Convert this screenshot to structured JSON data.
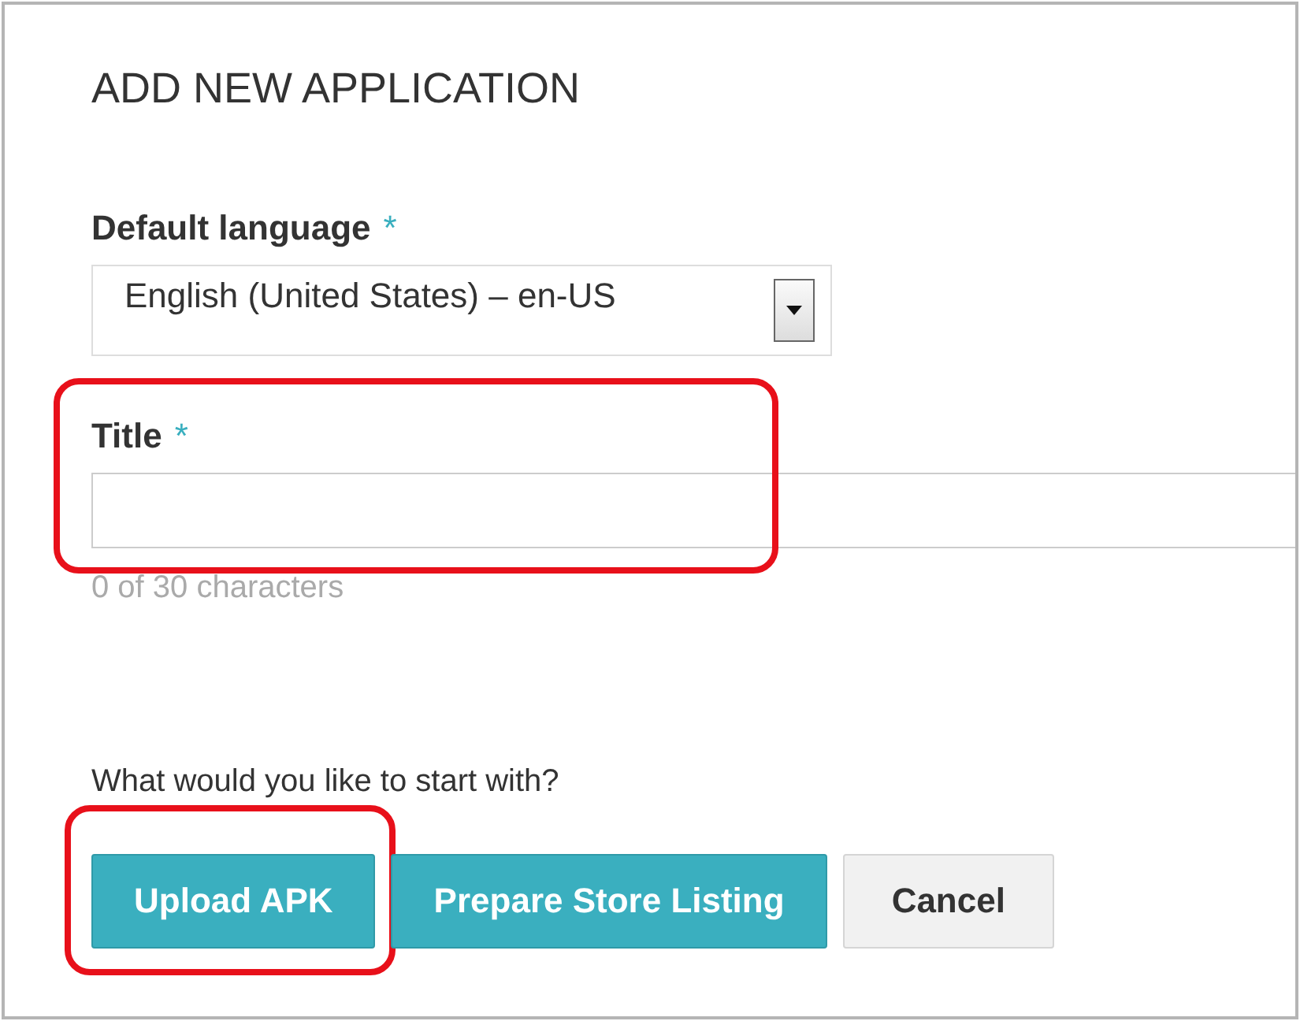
{
  "dialog": {
    "title": "ADD NEW APPLICATION"
  },
  "language": {
    "label": "Default language",
    "required_mark": "*",
    "value": "English (United States) – en-US"
  },
  "title_field": {
    "label": "Title",
    "required_mark": "*",
    "counter": "0 of 30 characters",
    "highlighted": true
  },
  "prompt": "What would you like to start with?",
  "buttons": [
    {
      "label": "Upload APK",
      "kind": "primary",
      "highlighted": true
    },
    {
      "label": "Prepare Store Listing",
      "kind": "primary",
      "highlighted": false
    },
    {
      "label": "Cancel",
      "kind": "default",
      "highlighted": false
    }
  ]
}
